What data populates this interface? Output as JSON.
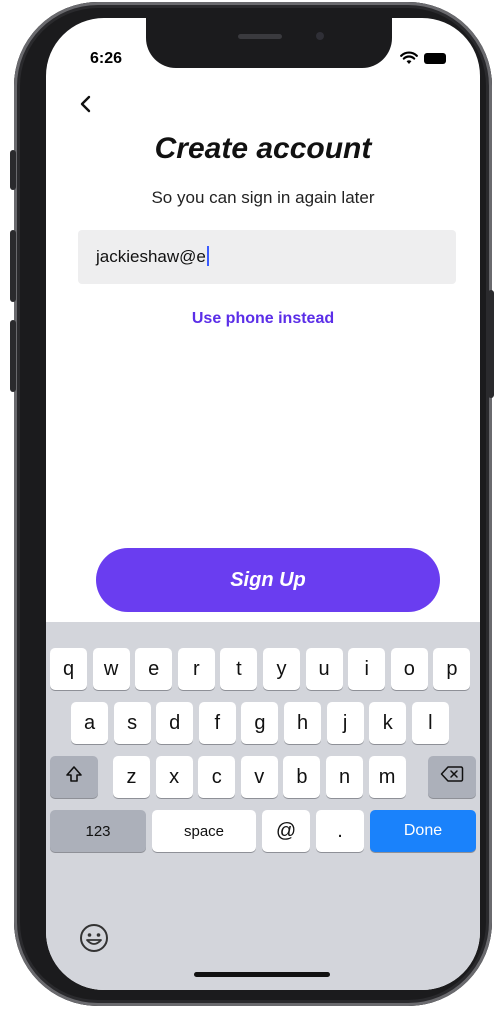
{
  "status": {
    "time": "6:26"
  },
  "header": {
    "title": "Create account",
    "subtitle": "So you can sign in again later"
  },
  "form": {
    "email_value": "jackieshaw@e",
    "alt_link": "Use phone instead",
    "submit_label": "Sign Up"
  },
  "keyboard": {
    "row1": [
      "q",
      "w",
      "e",
      "r",
      "t",
      "y",
      "u",
      "i",
      "o",
      "p"
    ],
    "row2": [
      "a",
      "s",
      "d",
      "f",
      "g",
      "h",
      "j",
      "k",
      "l"
    ],
    "row3": [
      "z",
      "x",
      "c",
      "v",
      "b",
      "n",
      "m"
    ],
    "numbers_label": "123",
    "space_label": "space",
    "at_label": "@",
    "dot_label": ".",
    "done_label": "Done"
  },
  "colors": {
    "accent": "#6a3df0",
    "link": "#5b2ee8",
    "done_key": "#1a82fb",
    "keyboard_bg": "#d3d5db"
  }
}
